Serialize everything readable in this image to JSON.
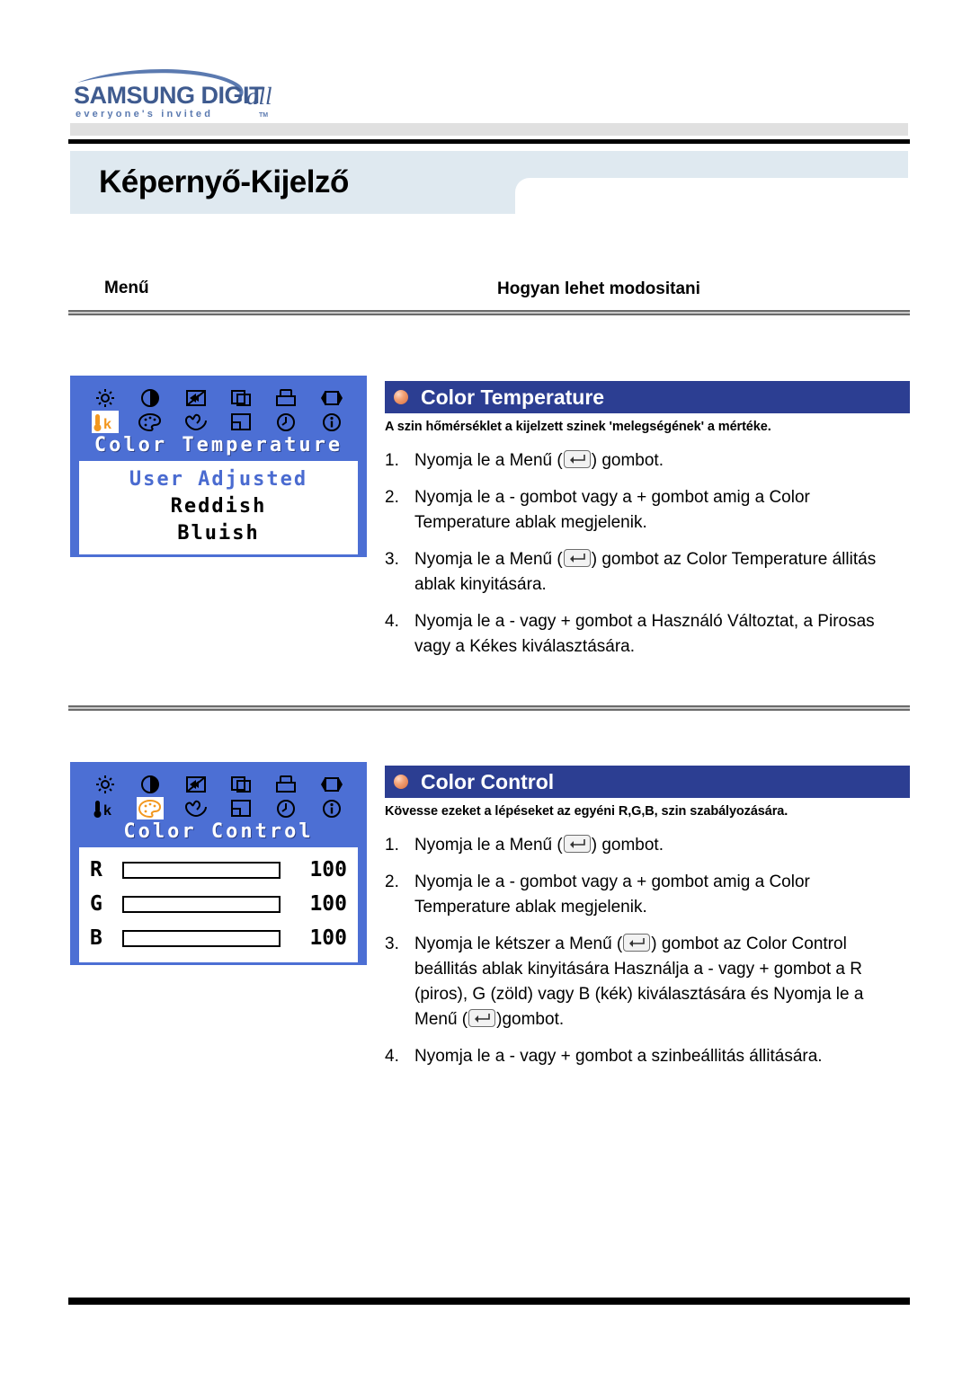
{
  "brand": {
    "logo_main": "SAMSUNG DIGITall",
    "logo_tagline": "everyone's invited",
    "logo_tm": "TM"
  },
  "page_title": "Képernyő-Kijelző",
  "columns": {
    "menu": "Menű",
    "how_to": "Hogyan lehet modositani"
  },
  "osd_temperature": {
    "title": "Color Temperature",
    "icons_row1": [
      "brightness-icon",
      "contrast-icon",
      "image-lock-icon",
      "position-icon",
      "size-icon",
      "h-position-icon"
    ],
    "icons_row2": [
      "color-temperature-icon",
      "color-control-icon",
      "color-balance-icon",
      "osd-position-icon",
      "reset-timer-icon",
      "information-icon"
    ],
    "selected_icon": "color-temperature-icon",
    "options": [
      {
        "label": "User Adjusted",
        "highlighted": true
      },
      {
        "label": "Reddish",
        "highlighted": false
      },
      {
        "label": "Bluish",
        "highlighted": false
      }
    ]
  },
  "osd_control": {
    "title": "Color Control",
    "selected_icon": "color-control-icon",
    "channels": [
      {
        "letter": "R",
        "value": "100",
        "percent": 100
      },
      {
        "letter": "G",
        "value": "100",
        "percent": 100
      },
      {
        "letter": "B",
        "value": "100",
        "percent": 100
      }
    ]
  },
  "section_temperature": {
    "heading": "Color Temperature",
    "subtitle": "A szin hőmérséklet a kijelzett szinek 'melegségének' a mértéke.",
    "steps": [
      {
        "num": "1.",
        "pre": "Nyomja le a Menű  (",
        "post": ") gombot.",
        "key": true,
        "tail": ""
      },
      {
        "num": "2.",
        "pre": "Nyomja le a - gombot vagy a + gombot amig a Color Temperature ablak megjelenik.",
        "post": "",
        "key": false,
        "tail": ""
      },
      {
        "num": "3.",
        "pre": "Nyomja le a Menű (",
        "post": ") gombot az Color Temperature állitás ablak kinyitására.",
        "key": true,
        "tail": ""
      },
      {
        "num": "4.",
        "pre": "Nyomja le a - vagy + gombot a Használó Változtat, a Pirosas vagy a Kékes kiválasztására.",
        "post": "",
        "key": false,
        "tail": ""
      }
    ]
  },
  "section_control": {
    "heading": "Color Control",
    "subtitle": "Kövesse ezeket a lépéseket az egyéni R,G,B, szin szabályozására.",
    "steps": [
      {
        "num": "1.",
        "pre": "Nyomja le a Menű  (",
        "post": ") gombot.",
        "key": true,
        "tail": ""
      },
      {
        "num": "2.",
        "pre": "Nyomja le a - gombot vagy a + gombot amig a Color Temperature ablak megjelenik.",
        "post": "",
        "key": false,
        "tail": ""
      },
      {
        "num": "3.",
        "pre": "Nyomja le kétszer a Menű (",
        "post": ") gombot az Color Control beállitás ablak kinyitására Használja a - vagy + gombot a R (piros), G (zöld) vagy B (kék) kiválasztására és Nyomja le a Menű (",
        "key": true,
        "tail": ")gombot."
      },
      {
        "num": "4.",
        "pre": "Nyomja le a - vagy + gombot a szinbeállitás állitására.",
        "post": "",
        "key": false,
        "tail": ""
      }
    ]
  },
  "colors": {
    "osd_blue": "#4c6fd4",
    "heading_blue": "#2c3e92",
    "banner_blue": "#dfe9f0",
    "bullet_orange": "#e07b44",
    "osd_highlight_text": "#4a6bd0"
  }
}
